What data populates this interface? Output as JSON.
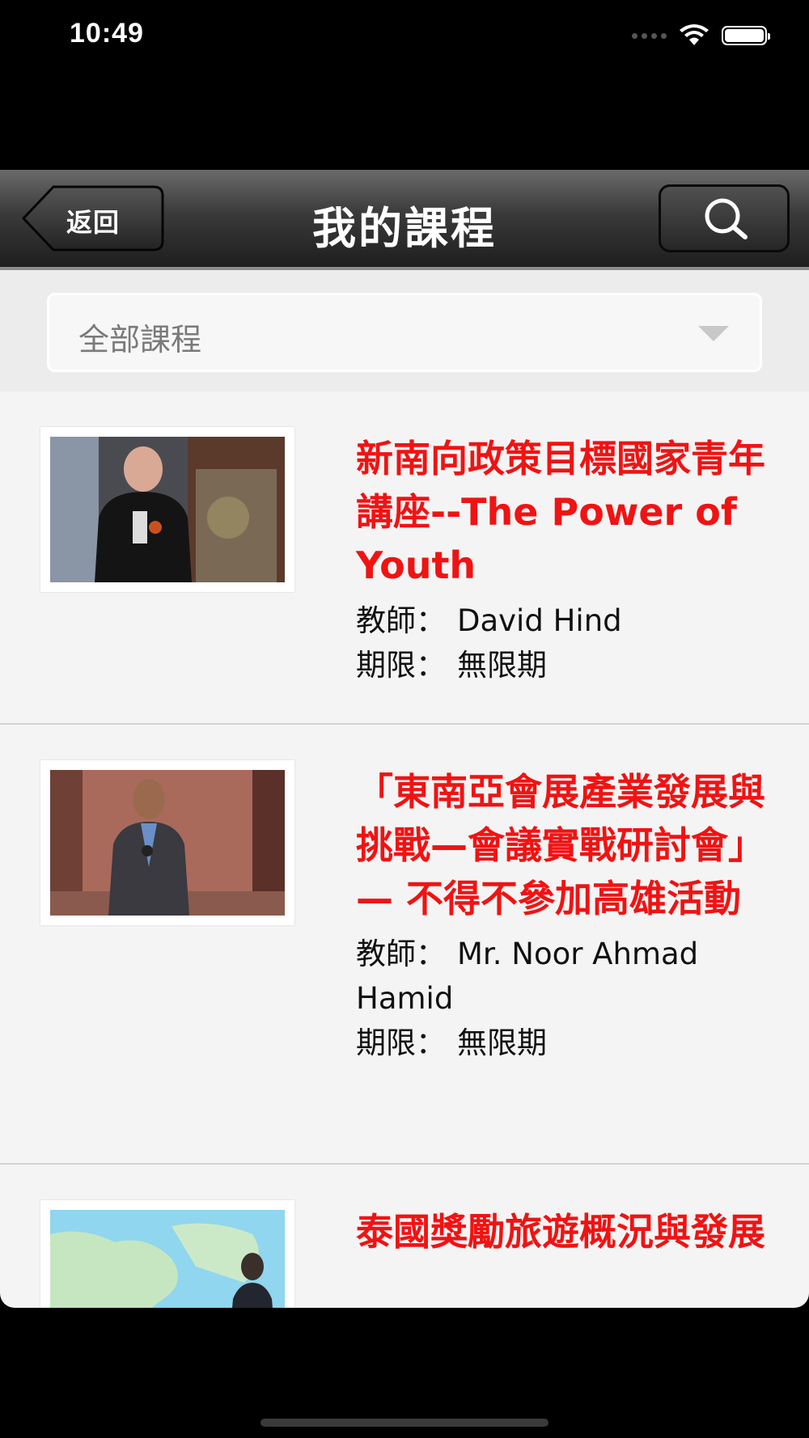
{
  "status_bar": {
    "time": "10:49"
  },
  "nav": {
    "back_label": "返回",
    "title": "我的課程",
    "search_icon": "search-icon"
  },
  "filter": {
    "selected": "全部課程"
  },
  "courses": [
    {
      "title": "新南向政策目標國家青年講座--The Power of Youth",
      "teacher_key": "教師：",
      "teacher": "David Hind",
      "period_key": "期限：",
      "period": "無限期"
    },
    {
      "title": "「東南亞會展產業發展與挑戰—會議實戰研討會」— 不得不參加高雄活動",
      "teacher_key": "教師：",
      "teacher": "Mr. Noor Ahmad Hamid",
      "period_key": "期限：",
      "period": "無限期"
    },
    {
      "title": "泰國獎勵旅遊概況與發展"
    }
  ],
  "colors": {
    "title_red": "#f01313",
    "nav_dark": "#2a2a2a"
  }
}
